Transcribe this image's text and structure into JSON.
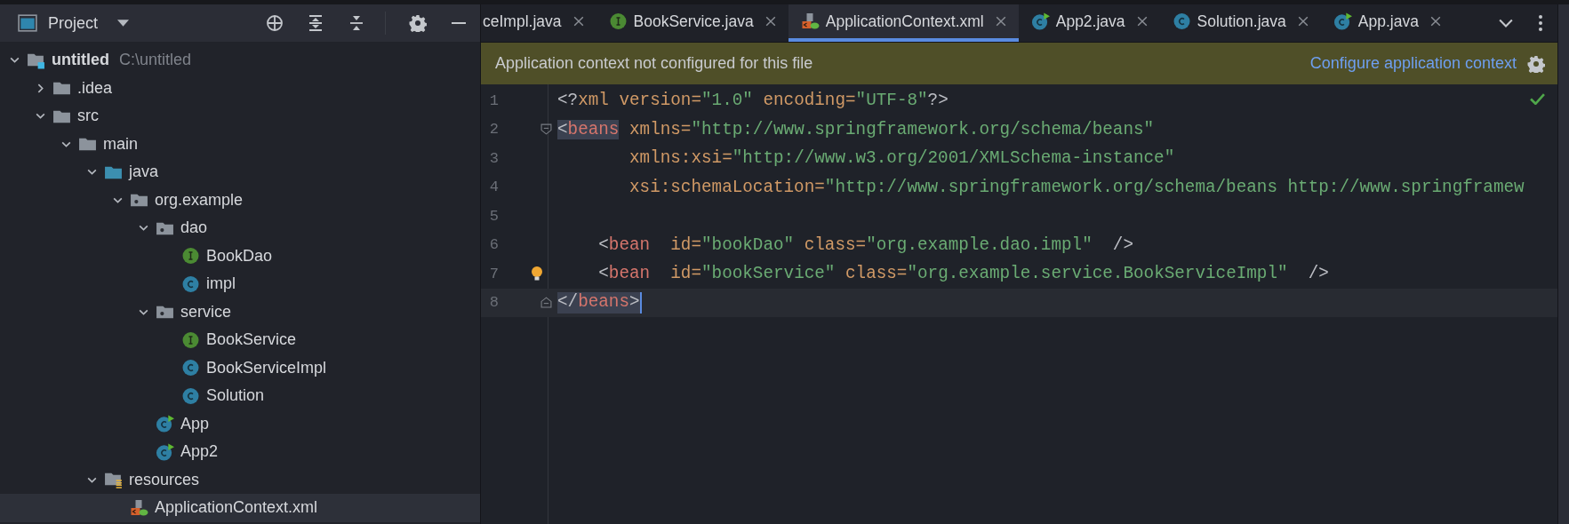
{
  "project_panel": {
    "title": "Project",
    "tree": [
      {
        "label": "untitled",
        "kind": "module",
        "path": "C:\\untitled",
        "expanded": true,
        "selected": false,
        "children": [
          {
            "label": ".idea",
            "kind": "folder",
            "expanded": false,
            "selected": false
          },
          {
            "label": "src",
            "kind": "folder",
            "expanded": true,
            "selected": false,
            "children": [
              {
                "label": "main",
                "kind": "folder",
                "expanded": true,
                "selected": false,
                "children": [
                  {
                    "label": "java",
                    "kind": "source-root",
                    "expanded": true,
                    "selected": false,
                    "children": [
                      {
                        "label": "org.example",
                        "kind": "package",
                        "expanded": true,
                        "selected": false,
                        "children": [
                          {
                            "label": "dao",
                            "kind": "package",
                            "expanded": true,
                            "selected": false,
                            "children": [
                              {
                                "label": "BookDao",
                                "kind": "interface",
                                "selected": false
                              },
                              {
                                "label": "impl",
                                "kind": "class",
                                "selected": false
                              }
                            ]
                          },
                          {
                            "label": "service",
                            "kind": "package",
                            "expanded": true,
                            "selected": false,
                            "children": [
                              {
                                "label": "BookService",
                                "kind": "interface",
                                "selected": false
                              },
                              {
                                "label": "BookServiceImpl",
                                "kind": "class",
                                "selected": false
                              },
                              {
                                "label": "Solution",
                                "kind": "class",
                                "selected": false
                              }
                            ]
                          },
                          {
                            "label": "App",
                            "kind": "main-class",
                            "selected": false
                          },
                          {
                            "label": "App2",
                            "kind": "main-class",
                            "selected": false
                          }
                        ]
                      }
                    ]
                  },
                  {
                    "label": "resources",
                    "kind": "resource-root",
                    "expanded": true,
                    "selected": false,
                    "children": [
                      {
                        "label": "ApplicationContext.xml",
                        "kind": "xml",
                        "selected": true
                      }
                    ]
                  }
                ]
              }
            ]
          }
        ]
      }
    ]
  },
  "editor": {
    "tabs": [
      {
        "label": "ceImpl.java",
        "kind": "none",
        "selected": false
      },
      {
        "label": "BookService.java",
        "kind": "interface",
        "selected": false
      },
      {
        "label": "ApplicationContext.xml",
        "kind": "xml",
        "selected": true
      },
      {
        "label": "App2.java",
        "kind": "main-class",
        "selected": false
      },
      {
        "label": "Solution.java",
        "kind": "class",
        "selected": false
      },
      {
        "label": "App.java",
        "kind": "main-class",
        "selected": false
      }
    ],
    "banner": {
      "message": "Application context not configured for this file",
      "link": "Configure application context"
    },
    "inspections_passed": true,
    "lines": [
      {
        "number": "1",
        "kind": "plain",
        "tokens": [
          {
            "kind": "punct",
            "text": "<?"
          },
          {
            "kind": "attr",
            "text": "xml version="
          },
          {
            "kind": "value",
            "text": "\"1.0\""
          },
          {
            "kind": "attr",
            "text": " encoding="
          },
          {
            "kind": "value",
            "text": "\"UTF-8\""
          },
          {
            "kind": "punct",
            "text": "?>"
          }
        ]
      },
      {
        "number": "2",
        "kind": "fold-start",
        "tokens": [
          {
            "kind": "punct",
            "text": "<",
            "highlighted": true
          },
          {
            "kind": "tag",
            "text": "beans",
            "highlighted": true
          },
          {
            "kind": "attr",
            "text": " xmlns="
          },
          {
            "kind": "value",
            "text": "\"http://www.springframework.org/schema/beans\""
          }
        ]
      },
      {
        "number": "3",
        "kind": "plain",
        "tokens": [
          {
            "kind": "attr",
            "text": "       xmlns:xsi="
          },
          {
            "kind": "value",
            "text": "\"http://www.w3.org/2001/XMLSchema-instance\""
          }
        ]
      },
      {
        "number": "4",
        "kind": "plain",
        "tokens": [
          {
            "kind": "attr",
            "text": "       xsi:schemaLocation="
          },
          {
            "kind": "value",
            "text": "\"http://www.springframework.org/schema/beans http://www.springframew"
          }
        ]
      },
      {
        "number": "5",
        "kind": "plain"
      },
      {
        "number": "6",
        "kind": "plain",
        "tokens": [
          {
            "kind": "punct",
            "text": "    <"
          },
          {
            "kind": "tag",
            "text": "bean"
          },
          {
            "kind": "attr",
            "text": "  id="
          },
          {
            "kind": "value",
            "text": "\"bookDao\""
          },
          {
            "kind": "attr",
            "text": " class="
          },
          {
            "kind": "value",
            "text": "\"org.example.dao.impl\""
          },
          {
            "kind": "punct",
            "text": "  />"
          }
        ]
      },
      {
        "number": "7",
        "kind": "bulb",
        "tokens": [
          {
            "kind": "punct",
            "text": "    <"
          },
          {
            "kind": "tag",
            "text": "bean"
          },
          {
            "kind": "attr",
            "text": "  id="
          },
          {
            "kind": "value",
            "text": "\"bookService\""
          },
          {
            "kind": "attr",
            "text": " class="
          },
          {
            "kind": "value",
            "text": "\"org.example.service.BookServiceImpl\""
          },
          {
            "kind": "punct",
            "text": "  />"
          }
        ]
      },
      {
        "number": "8",
        "kind": "fold-end",
        "current": true,
        "tokens": [
          {
            "kind": "punct",
            "text": "</",
            "highlighted": true
          },
          {
            "kind": "tag",
            "text": "beans",
            "highlighted": true
          },
          {
            "kind": "punct",
            "text": ">",
            "highlighted": true
          }
        ]
      }
    ]
  }
}
